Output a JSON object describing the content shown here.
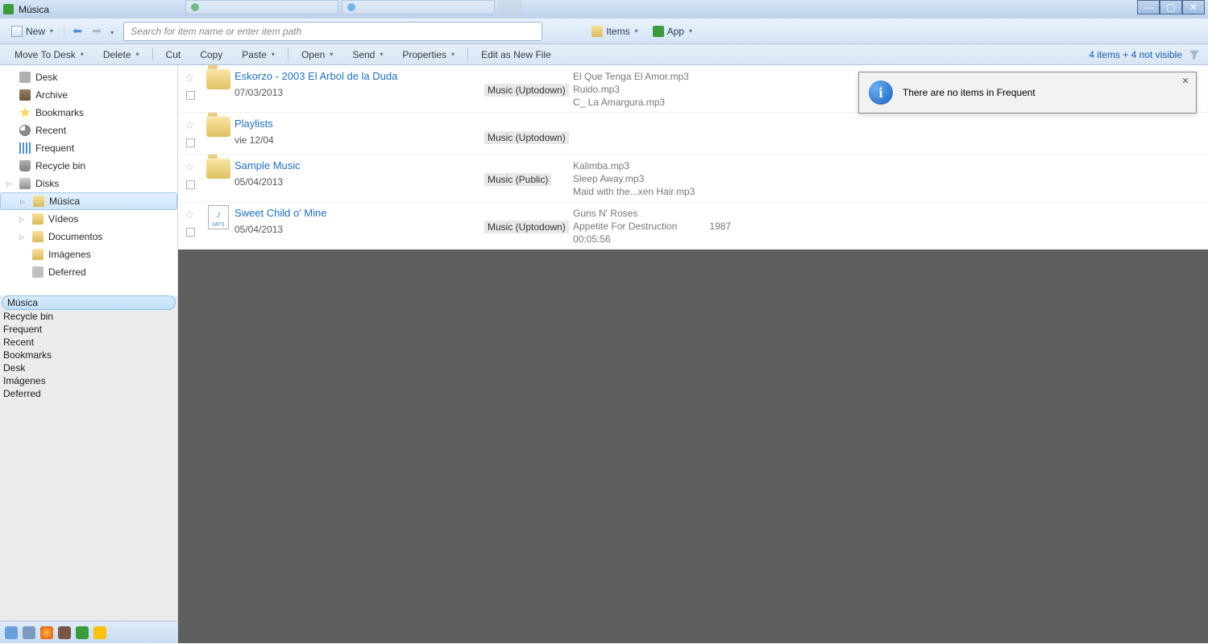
{
  "window": {
    "title": "Música"
  },
  "toolbar1": {
    "new": "New",
    "search_placeholder": "Search for item name or enter item path",
    "items": "Items",
    "app": "App"
  },
  "toolbar2": {
    "move_to_desk": "Move To Desk",
    "delete": "Delete",
    "cut": "Cut",
    "copy": "Copy",
    "paste": "Paste",
    "open": "Open",
    "send": "Send",
    "properties": "Properties",
    "edit_as_new": "Edit as New File",
    "status": "4 items + 4 not visible"
  },
  "tree": {
    "desk": "Desk",
    "archive": "Archive",
    "bookmarks": "Bookmarks",
    "recent": "Recent",
    "frequent": "Frequent",
    "recycle": "Recycle bin",
    "disks": "Disks",
    "musica": "Música",
    "videos": "Vídeos",
    "documentos": "Documentos",
    "imagenes": "Imágenes",
    "deferred": "Deferred"
  },
  "lowerlist": {
    "items": [
      "Música",
      "Recycle bin",
      "Frequent",
      "Recent",
      "Bookmarks",
      "Desk",
      "Imágenes",
      "Deferred"
    ]
  },
  "rows": [
    {
      "name": "Eskorzo - 2003 El Arbol de la Duda",
      "date": "07/03/2013",
      "location": "Music (Uptodown)",
      "meta": [
        "El Que Tenga El Amor.mp3",
        "Ruido.mp3",
        "C_ La Amargura.mp3"
      ],
      "type": "folder"
    },
    {
      "name": "Playlists",
      "date": "vie 12/04",
      "location": "Music (Uptodown)",
      "meta": [],
      "type": "folder"
    },
    {
      "name": "Sample Music",
      "date": "05/04/2013",
      "location": "Music (Public)",
      "meta": [
        "Kalimba.mp3",
        "Sleep Away.mp3",
        "Maid with the...xen Hair.mp3"
      ],
      "type": "folder"
    },
    {
      "name": "Sweet Child o' Mine",
      "date": "05/04/2013",
      "location": "Music (Uptodown)",
      "meta": [
        "Guns N' Roses",
        "Appetite For Destruction",
        "00:05:56"
      ],
      "year": "1987",
      "type": "mp3"
    }
  ],
  "notification": {
    "text": "There are no items in Frequent"
  }
}
